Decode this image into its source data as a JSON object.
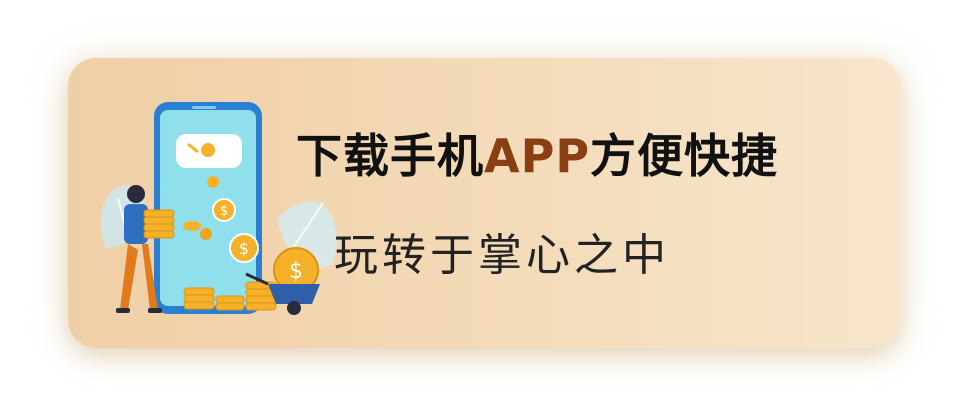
{
  "banner": {
    "headline_part1": "下载手机",
    "headline_accent": "APP",
    "headline_part2": "方便快捷",
    "subline": "玩转于掌心之中",
    "accent_color": "#8a3f12",
    "background_color": "#f3d9b6"
  },
  "icons": [
    "phone-illustration",
    "person-figure",
    "coin-stack-icon",
    "dollar-coin-icon",
    "wheelbarrow-icon"
  ]
}
